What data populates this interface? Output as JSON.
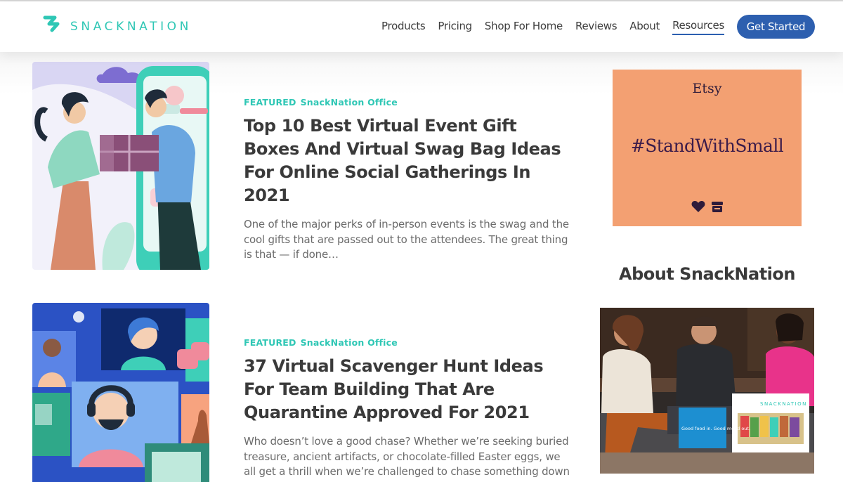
{
  "brand": {
    "name": "SNACKNATION",
    "accent": "#2fc7b5"
  },
  "nav": {
    "items": [
      {
        "label": "Products",
        "active": false
      },
      {
        "label": "Pricing",
        "active": false
      },
      {
        "label": "Shop For Home",
        "active": false
      },
      {
        "label": "Reviews",
        "active": false
      },
      {
        "label": "About",
        "active": false
      },
      {
        "label": "Resources",
        "active": true
      }
    ],
    "cta": "Get Started",
    "cta_color": "#2d5faf"
  },
  "posts": [
    {
      "categories": [
        "FEATURED",
        "SnackNation Office"
      ],
      "title": "Top 10 Best Virtual Event Gift Boxes And Virtual Swag Bag Ideas For Online Social Gatherings In 2021",
      "excerpt": "One of the major perks of in-person events is the swag and the cool gifts that are passed out to the attendees. The great thing is that — if done…",
      "image_icon": "gift-exchange-illustration"
    },
    {
      "categories": [
        "FEATURED",
        "SnackNation Office"
      ],
      "title": "37 Virtual Scavenger Hunt Ideas For Team Building That Are Quarantine Approved For 2021",
      "excerpt": "Who doesn’t love a good chase? Whether we’re seeking buried treasure, ancient artifacts, or chocolate-filled Easter eggs, we all get a thrill when we’re challenged to chase something down",
      "image_icon": "video-call-illustration"
    }
  ],
  "sidebar": {
    "ad": {
      "brand": "Etsy",
      "tagline": "#StandWithSmall",
      "background": "#f3a072"
    },
    "about_title": "About SnackNation",
    "photo": {
      "box_brand": "SNACKNATION",
      "box_slogan": "Good food in. Good mood out."
    }
  }
}
